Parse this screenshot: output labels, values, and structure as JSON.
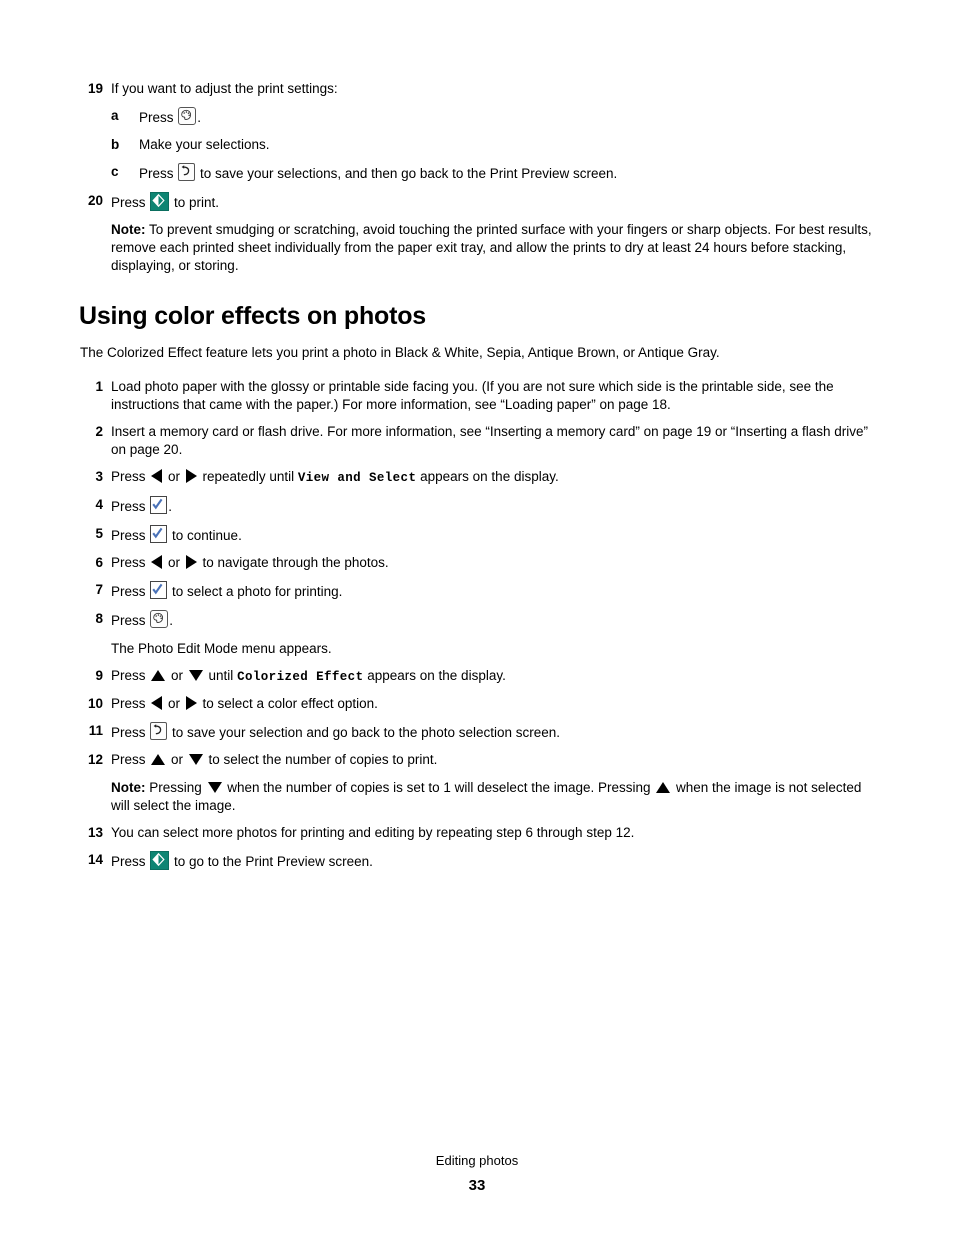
{
  "document": {
    "footer_section": "Editing photos",
    "page_number": "33"
  },
  "colors": {
    "start_button_teal": "#0e8573",
    "check_blue": "#4a72b8",
    "text_black": "#000000",
    "page_background": "#ffffff"
  },
  "step19": {
    "number": "19",
    "text": "If you want to adjust the print settings:",
    "substeps": [
      {
        "letter": "a",
        "before_icon": "Press ",
        "icon": "menu-icon",
        "after_icon": "."
      },
      {
        "letter": "b",
        "before_icon": "Make your selections.",
        "icon": "",
        "after_icon": ""
      },
      {
        "letter": "c",
        "before_icon": "Press ",
        "icon": "back-icon",
        "after_icon": " to save your selections, and then go back to the Print Preview screen."
      }
    ]
  },
  "step20": {
    "number": "20",
    "before_icon": "Press ",
    "icon": "start-icon",
    "after_icon": " to print."
  },
  "note_top": {
    "label": "Note:",
    "text": " To prevent smudging or scratching, avoid touching the printed surface with your fingers or sharp objects. For best results, remove each printed sheet individually from the paper exit tray, and allow the prints to dry at least 24 hours before stacking, displaying, or storing."
  },
  "section": {
    "heading": "Using color effects on photos",
    "intro": "The Colorized Effect feature lets you print a photo in Black & White, Sepia, Antique Brown, or Antique Gray."
  },
  "steps": [
    {
      "number": "1",
      "text": "Load photo paper with the glossy or printable side facing you. (If you are not sure which side is the printable side, see the instructions that came with the paper.) For more information, see “Loading paper” on page 18."
    },
    {
      "number": "2",
      "text": "Insert a memory card or flash drive. For more information, see “Inserting a memory card” on page 19 or “Inserting a flash drive” on page 20."
    },
    {
      "number": "3",
      "parts": [
        {
          "t": "text",
          "v": "Press "
        },
        {
          "t": "icon",
          "v": "left-arrow-icon"
        },
        {
          "t": "text",
          "v": " or "
        },
        {
          "t": "icon",
          "v": "right-arrow-icon"
        },
        {
          "t": "text",
          "v": " repeatedly until "
        },
        {
          "t": "cmd",
          "v": "View and Select"
        },
        {
          "t": "text",
          "v": " appears on the display."
        }
      ]
    },
    {
      "number": "4",
      "parts": [
        {
          "t": "text",
          "v": "Press "
        },
        {
          "t": "icon",
          "v": "select-check-icon"
        },
        {
          "t": "text",
          "v": "."
        }
      ]
    },
    {
      "number": "5",
      "parts": [
        {
          "t": "text",
          "v": "Press "
        },
        {
          "t": "icon",
          "v": "select-check-icon"
        },
        {
          "t": "text",
          "v": " to continue."
        }
      ]
    },
    {
      "number": "6",
      "parts": [
        {
          "t": "text",
          "v": "Press "
        },
        {
          "t": "icon",
          "v": "left-arrow-icon"
        },
        {
          "t": "text",
          "v": " or "
        },
        {
          "t": "icon",
          "v": "right-arrow-icon"
        },
        {
          "t": "text",
          "v": " to navigate through the photos."
        }
      ]
    },
    {
      "number": "7",
      "parts": [
        {
          "t": "text",
          "v": "Press "
        },
        {
          "t": "icon",
          "v": "select-check-icon"
        },
        {
          "t": "text",
          "v": " to select a photo for printing."
        }
      ]
    },
    {
      "number": "8",
      "parts": [
        {
          "t": "text",
          "v": "Press "
        },
        {
          "t": "icon",
          "v": "menu-icon"
        },
        {
          "t": "text",
          "v": "."
        }
      ],
      "follow_text": "The Photo Edit Mode menu appears."
    },
    {
      "number": "9",
      "parts": [
        {
          "t": "text",
          "v": "Press "
        },
        {
          "t": "icon",
          "v": "up-arrow-icon"
        },
        {
          "t": "text",
          "v": " or "
        },
        {
          "t": "icon",
          "v": "down-arrow-icon"
        },
        {
          "t": "text",
          "v": " until "
        },
        {
          "t": "cmd",
          "v": "Colorized Effect"
        },
        {
          "t": "text",
          "v": " appears on the display."
        }
      ]
    },
    {
      "number": "10",
      "parts": [
        {
          "t": "text",
          "v": "Press "
        },
        {
          "t": "icon",
          "v": "left-arrow-icon"
        },
        {
          "t": "text",
          "v": " or "
        },
        {
          "t": "icon",
          "v": "right-arrow-icon"
        },
        {
          "t": "text",
          "v": " to select a color effect option."
        }
      ]
    },
    {
      "number": "11",
      "parts": [
        {
          "t": "text",
          "v": "Press "
        },
        {
          "t": "icon",
          "v": "back-icon"
        },
        {
          "t": "text",
          "v": " to save your selection and go back to the photo selection screen."
        }
      ]
    },
    {
      "number": "12",
      "parts": [
        {
          "t": "text",
          "v": "Press "
        },
        {
          "t": "icon",
          "v": "up-arrow-icon"
        },
        {
          "t": "text",
          "v": " or "
        },
        {
          "t": "icon",
          "v": "down-arrow-icon"
        },
        {
          "t": "text",
          "v": " to select the number of copies to print."
        }
      ]
    },
    {
      "number": "13",
      "text": "You can select more photos for printing and editing by repeating step 6 through step 12."
    },
    {
      "number": "14",
      "parts": [
        {
          "t": "text",
          "v": "Press "
        },
        {
          "t": "icon",
          "v": "start-icon"
        },
        {
          "t": "text",
          "v": " to go to the Print Preview screen."
        }
      ]
    }
  ],
  "note_copies": {
    "label": "Note:",
    "part1": " Pressing ",
    "icon1": "down-arrow-icon",
    "part2": " when the number of copies is set to 1 will deselect the image. Pressing ",
    "icon2": "up-arrow-icon",
    "part3": " when the image is not selected will select the image."
  }
}
